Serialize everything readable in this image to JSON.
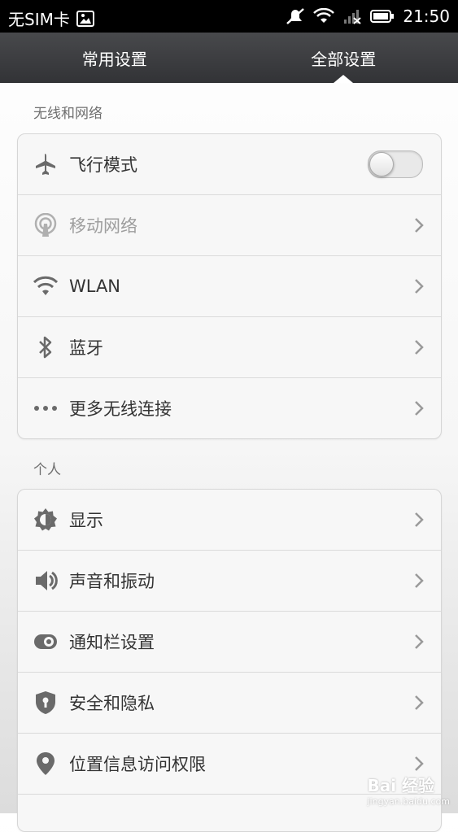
{
  "status_bar": {
    "carrier": "无SIM卡",
    "time": "21:50"
  },
  "tabs": [
    {
      "label": "常用设置",
      "active": false
    },
    {
      "label": "全部设置",
      "active": true
    }
  ],
  "sections": [
    {
      "title": "无线和网络",
      "items": [
        {
          "label": "飞行模式",
          "icon": "airplane-icon",
          "control": "toggle",
          "on": false
        },
        {
          "label": "移动网络",
          "icon": "cellular-antenna-icon",
          "disabled": true
        },
        {
          "label": "WLAN",
          "icon": "wifi-icon"
        },
        {
          "label": "蓝牙",
          "icon": "bluetooth-icon"
        },
        {
          "label": "更多无线连接",
          "icon": "more-dots-icon"
        }
      ]
    },
    {
      "title": "个人",
      "items": [
        {
          "label": "显示",
          "icon": "brightness-icon"
        },
        {
          "label": "声音和振动",
          "icon": "speaker-icon"
        },
        {
          "label": "通知栏设置",
          "icon": "notification-toggle-icon"
        },
        {
          "label": "安全和隐私",
          "icon": "shield-lock-icon"
        },
        {
          "label": "位置信息访问权限",
          "icon": "location-pin-icon"
        }
      ]
    }
  ],
  "colors": {
    "tabbar": "#3c3d40",
    "icon": "#6a6a6a",
    "text": "#333333",
    "disabled_text": "#9e9e9e"
  },
  "watermark": {
    "brand": "Bai 经验",
    "url": "jingyan.baidu.com"
  }
}
